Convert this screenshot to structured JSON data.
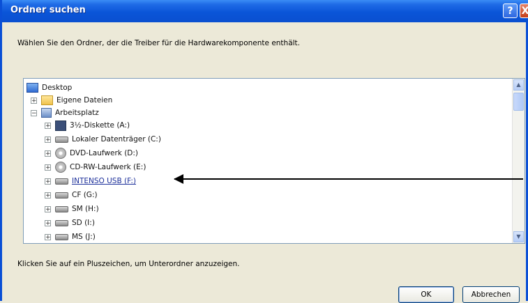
{
  "window": {
    "title": "Ordner suchen"
  },
  "titlebar_buttons": {
    "help": "?",
    "close": "X"
  },
  "instruction": "Wählen Sie den Ordner, der die Treiber für die Hardwarekomponente enthält.",
  "tree": [
    {
      "label": "Desktop",
      "icon": "desktop-icon",
      "expander": ""
    },
    {
      "label": "Eigene Dateien",
      "icon": "folder-icon",
      "expander": "+"
    },
    {
      "label": "Arbeitsplatz",
      "icon": "computer-icon",
      "expander": "−"
    },
    {
      "label": "3½-Diskette (A:)",
      "icon": "floppy-icon",
      "expander": "+"
    },
    {
      "label": "Lokaler Datenträger (C:)",
      "icon": "drive-icon",
      "expander": "+"
    },
    {
      "label": "DVD-Laufwerk (D:)",
      "icon": "cd-drive-icon",
      "expander": "+"
    },
    {
      "label": "CD-RW-Laufwerk (E:)",
      "icon": "cd-drive-icon",
      "expander": "+"
    },
    {
      "label": "INTENSO USB (F:)",
      "icon": "drive-icon",
      "expander": "+"
    },
    {
      "label": "CF (G:)",
      "icon": "drive-icon",
      "expander": "+"
    },
    {
      "label": "SM (H:)",
      "icon": "drive-icon",
      "expander": "+"
    },
    {
      "label": "SD (I:)",
      "icon": "drive-icon",
      "expander": "+"
    },
    {
      "label": "MS (J:)",
      "icon": "drive-icon",
      "expander": "+"
    }
  ],
  "hint": "Klicken Sie auf ein Pluszeichen, um Unterordner anzuzeigen.",
  "buttons": {
    "ok": "OK",
    "cancel": "Abbrechen"
  },
  "scrollbar": {
    "up": "▲",
    "down": "▼"
  },
  "colors": {
    "titlebar": "#0a55d8",
    "dialog": "#ece9d8",
    "highlight_link": "#1c2f9a"
  }
}
